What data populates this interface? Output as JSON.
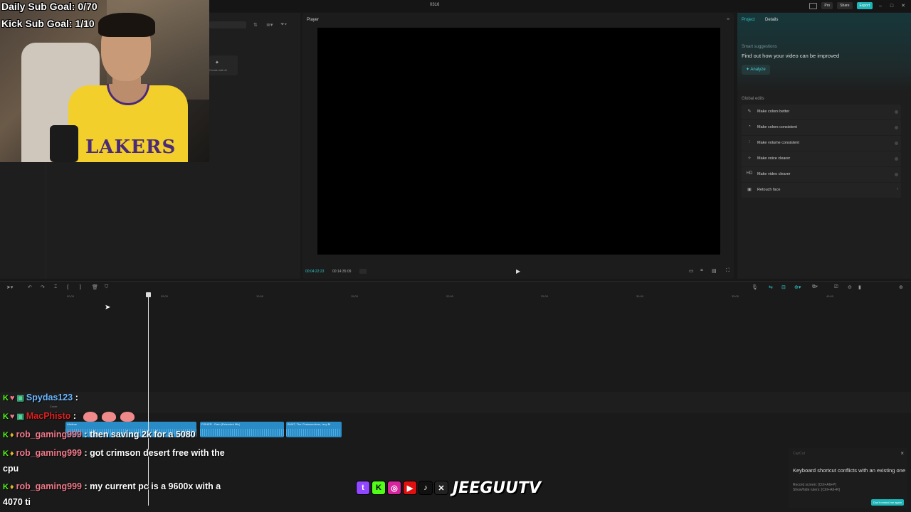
{
  "window": {
    "title": "0316"
  },
  "titlebar": {
    "pro_label": "Pro",
    "share_label": "Share",
    "export_label": "Export"
  },
  "media": {
    "ai_label": "Create with AI"
  },
  "player": {
    "title": "Player",
    "current_time": "00:04:22:23",
    "total_time": "00:14:35:09"
  },
  "right_panel": {
    "tabs": [
      "Project",
      "Details"
    ],
    "smart_title": "Smart suggestions",
    "smart_desc": "Find out how your video can be improved",
    "analyze_label": "Analyze",
    "global_title": "Global edits",
    "items": [
      {
        "label": "Make colors better",
        "icon": "wand-icon"
      },
      {
        "label": "Make colors consistent",
        "icon": "palette-icon"
      },
      {
        "label": "Make volume consistent",
        "icon": "sliders-icon"
      },
      {
        "label": "Make voice clearer",
        "icon": "voice-icon"
      },
      {
        "label": "Make video clearer",
        "icon": "hd-icon"
      },
      {
        "label": "Retouch face",
        "icon": "face-icon"
      }
    ]
  },
  "timeline": {
    "ticks": [
      "00:00",
      "05:00",
      "10:00",
      "15:00",
      "20:00",
      "25:00",
      "30:00",
      "35:00",
      "40:00"
    ],
    "cover_label": "Cover",
    "clips": [
      {
        "label": "Lifetime"
      },
      {
        "label": "FISHER - Rain (Extended Mix)"
      },
      {
        "label": "BUNT, The Chainsmokers, Izzy Bi"
      }
    ]
  },
  "toast": {
    "app": "CapCut",
    "message": "Keyboard shortcut conflicts with an existing one",
    "shortcut1": "Record screen: [Ctrl+Alt+P]",
    "shortcut2": "Show/hide rulers: [Ctrl+Alt+R]",
    "button": "Don't remind me again"
  },
  "overlay": {
    "daily_goal": "Daily Sub Goal: 0/70",
    "kick_goal": "Kick Sub Goal: 1/10",
    "brand": "JEEGUUTV",
    "jersey_text": "LAKERS",
    "chat": [
      {
        "user": "Spydas123",
        "text": ""
      },
      {
        "user": "MacPhisto",
        "text": ""
      },
      {
        "user": "rob_gaming999",
        "text": "then saving 2k for a 5080"
      },
      {
        "user": "rob_gaming999",
        "text": "got crimson desert free with the",
        "wrap": "cpu"
      },
      {
        "user": "rob_gaming999",
        "text": "my current pc is a 9600x with a",
        "wrap": "4070 ti"
      }
    ]
  }
}
